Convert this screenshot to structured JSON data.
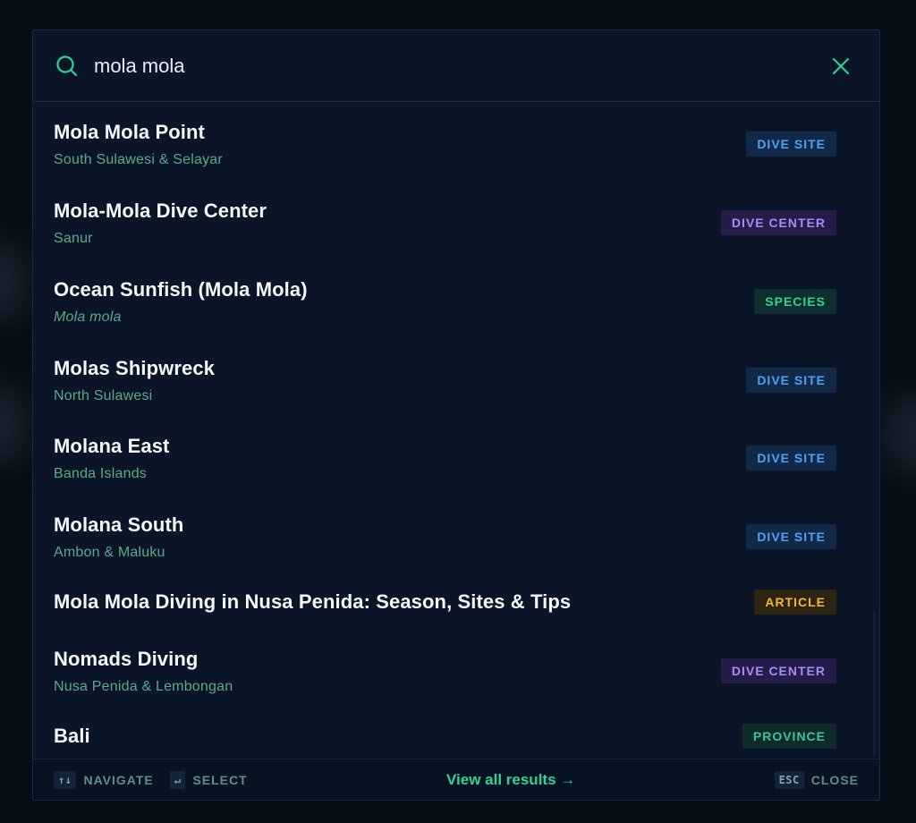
{
  "search": {
    "query": "mola mola",
    "placeholder": ""
  },
  "results": [
    {
      "title": "Mola Mola Point",
      "subtitle": "South Sulawesi & Selayar",
      "badge": "DIVE SITE",
      "type": "dive-site"
    },
    {
      "title": "Mola-Mola Dive Center",
      "subtitle": "Sanur",
      "badge": "DIVE CENTER",
      "type": "dive-center"
    },
    {
      "title": "Ocean Sunfish (Mola Mola)",
      "subtitle": "Mola mola",
      "badge": "SPECIES",
      "type": "species"
    },
    {
      "title": "Molas Shipwreck",
      "subtitle": "North Sulawesi",
      "badge": "DIVE SITE",
      "type": "dive-site"
    },
    {
      "title": "Molana East",
      "subtitle": "Banda Islands",
      "badge": "DIVE SITE",
      "type": "dive-site"
    },
    {
      "title": "Molana South",
      "subtitle": "Ambon & Maluku",
      "badge": "DIVE SITE",
      "type": "dive-site"
    },
    {
      "title": "Mola Mola Diving in Nusa Penida: Season, Sites & Tips",
      "subtitle": "",
      "badge": "ARTICLE",
      "type": "article"
    },
    {
      "title": "Nomads Diving",
      "subtitle": "Nusa Penida & Lembongan",
      "badge": "DIVE CENTER",
      "type": "dive-center"
    },
    {
      "title": "Bali",
      "subtitle": "",
      "badge": "PROVINCE",
      "type": "province"
    }
  ],
  "footer": {
    "navigate_key": "↑↓",
    "navigate_label": "NAVIGATE",
    "select_key": "↵",
    "select_label": "SELECT",
    "view_all": "View all results →",
    "esc_key": "ESC",
    "close_label": "CLOSE"
  },
  "colors": {
    "accent": "#2ed29b",
    "dive_site": "#4ea3f0",
    "dive_center": "#a88bf2",
    "species": "#2ed29b",
    "article": "#f0b83a",
    "province": "#3fc49a"
  },
  "icons": {
    "search": "search-icon",
    "close": "close-icon"
  }
}
